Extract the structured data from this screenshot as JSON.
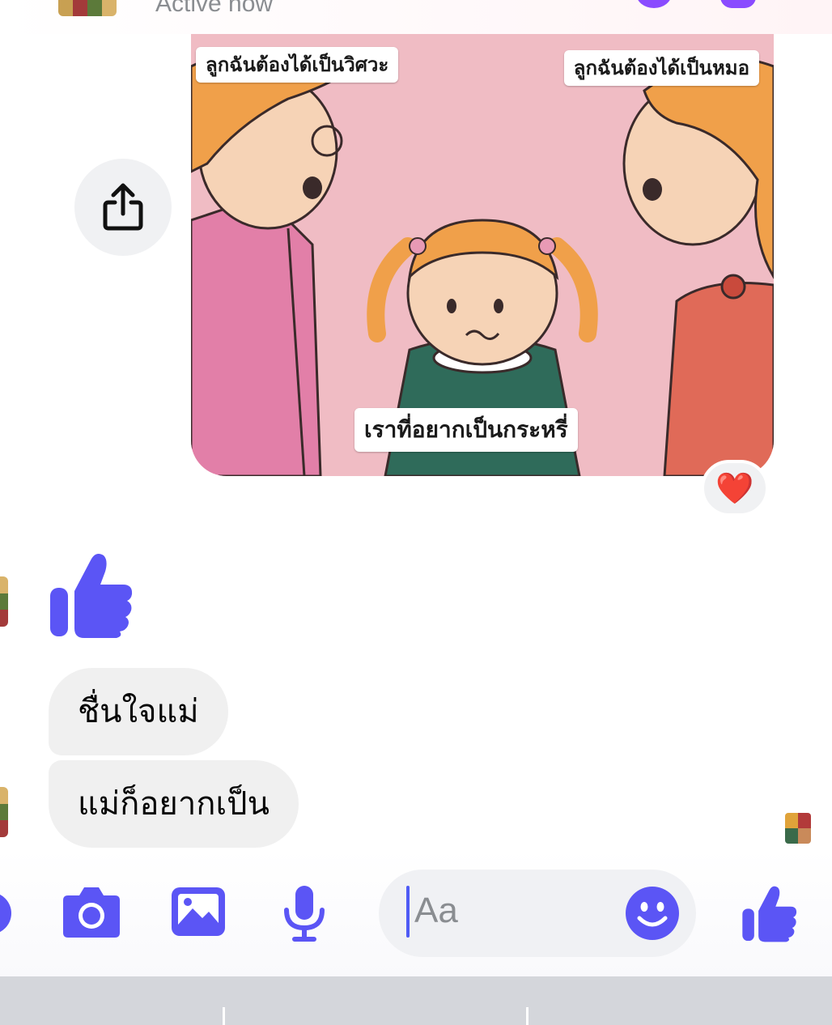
{
  "header": {
    "status": "Active now"
  },
  "shared_image": {
    "caption_left": "ลูกฉันต้องได้เป็นวิศวะ",
    "caption_right": "ลูกฉันต้องได้เป็นหมอ",
    "caption_bottom": "เราที่อยากเป็นกระหรี่",
    "reaction": "❤️"
  },
  "messages": [
    {
      "type": "like-sticker"
    },
    {
      "type": "text",
      "text": "ชื่นใจแม่"
    },
    {
      "type": "text",
      "text": "แม่ก็อยากเป็น"
    }
  ],
  "composer": {
    "placeholder": "Aa",
    "icons": [
      "more-icon",
      "camera-icon",
      "image-icon",
      "microphone-icon",
      "emoji-icon",
      "like-icon"
    ]
  },
  "colors": {
    "accent": "#5b55f5",
    "bubble": "#f0f0f0",
    "comic_background": "#f0bcc4"
  }
}
